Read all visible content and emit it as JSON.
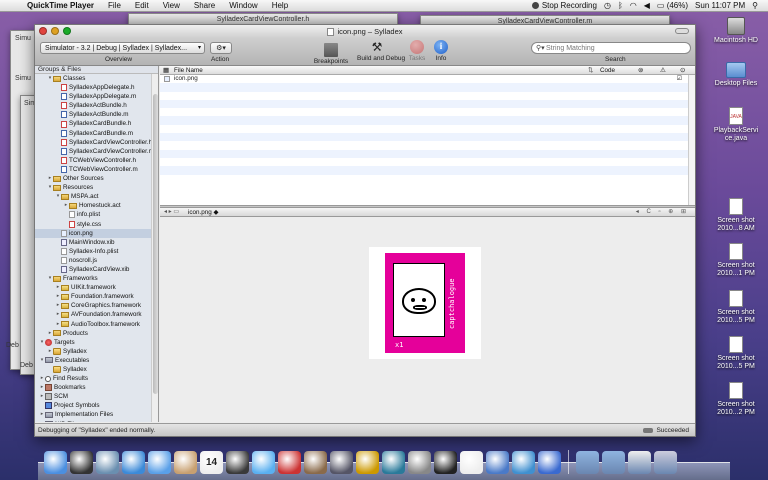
{
  "menubar": {
    "app": "QuickTime Player",
    "items": [
      "File",
      "Edit",
      "View",
      "Share",
      "Window",
      "Help"
    ],
    "stop_recording": "Stop Recording",
    "battery": "(46%)",
    "clock": "Sun 11:07 PM"
  },
  "bg_windows": {
    "header_file": "SylladexCardViewController.h",
    "impl_file": "SylladexCardViewController.m",
    "sim_tabs": [
      "Simu",
      "Simu",
      "Simu"
    ],
    "deb_labels": [
      "Deb",
      "Deb"
    ]
  },
  "xcode": {
    "title": "icon.png – Sylladex",
    "toolbar": {
      "overview_popup": "Simulator - 3.2 | Debug | Sylladex | Sylladex...",
      "overview_label": "Overview",
      "action_label": "Action",
      "breakpoints": "Breakpoints",
      "build_debug": "Build and Debug",
      "tasks": "Tasks",
      "info": "Info",
      "search_placeholder": "String Matching",
      "search_label": "Search"
    },
    "sidebar": {
      "header": "Groups & Files",
      "rows": [
        {
          "label": "Classes",
          "indent": 2,
          "icon": "folder",
          "tri": "▾"
        },
        {
          "label": "SylladexAppDelegate.h",
          "indent": 3,
          "icon": "h",
          "tri": ""
        },
        {
          "label": "SylladexAppDelegate.m",
          "indent": 3,
          "icon": "m",
          "tri": ""
        },
        {
          "label": "SylladexActBundle.h",
          "indent": 3,
          "icon": "h",
          "tri": ""
        },
        {
          "label": "SylladexActBundle.m",
          "indent": 3,
          "icon": "m",
          "tri": ""
        },
        {
          "label": "SylladexCardBundle.h",
          "indent": 3,
          "icon": "h",
          "tri": ""
        },
        {
          "label": "SylladexCardBundle.m",
          "indent": 3,
          "icon": "m",
          "tri": ""
        },
        {
          "label": "SylladexCardViewController.h",
          "indent": 3,
          "icon": "h",
          "tri": ""
        },
        {
          "label": "SylladexCardViewController.m",
          "indent": 3,
          "icon": "m",
          "tri": ""
        },
        {
          "label": "TCWebViewController.h",
          "indent": 3,
          "icon": "h",
          "tri": ""
        },
        {
          "label": "TCWebViewController.m",
          "indent": 3,
          "icon": "m",
          "tri": ""
        },
        {
          "label": "Other Sources",
          "indent": 2,
          "icon": "folder",
          "tri": "▸"
        },
        {
          "label": "Resources",
          "indent": 2,
          "icon": "folder",
          "tri": "▾"
        },
        {
          "label": "MSPA.act",
          "indent": 3,
          "icon": "folder",
          "tri": "▾"
        },
        {
          "label": "Homestuck.act",
          "indent": 4,
          "icon": "folder",
          "tri": "▸"
        },
        {
          "label": "info.plist",
          "indent": 4,
          "icon": "file",
          "tri": ""
        },
        {
          "label": "style.css",
          "indent": 4,
          "icon": "h",
          "tri": ""
        },
        {
          "label": "icon.png",
          "indent": 3,
          "icon": "png",
          "tri": "",
          "selected": true
        },
        {
          "label": "MainWindow.xib",
          "indent": 3,
          "icon": "xib",
          "tri": ""
        },
        {
          "label": "Sylladex-Info.plist",
          "indent": 3,
          "icon": "file",
          "tri": ""
        },
        {
          "label": "noscroll.js",
          "indent": 3,
          "icon": "file",
          "tri": ""
        },
        {
          "label": "SylladexCardView.xib",
          "indent": 3,
          "icon": "xib",
          "tri": ""
        },
        {
          "label": "Frameworks",
          "indent": 2,
          "icon": "folder",
          "tri": "▾"
        },
        {
          "label": "UIKit.framework",
          "indent": 3,
          "icon": "framework",
          "tri": "▸"
        },
        {
          "label": "Foundation.framework",
          "indent": 3,
          "icon": "framework",
          "tri": "▸"
        },
        {
          "label": "CoreGraphics.framework",
          "indent": 3,
          "icon": "framework",
          "tri": "▸"
        },
        {
          "label": "AVFoundation.framework",
          "indent": 3,
          "icon": "framework",
          "tri": "▸"
        },
        {
          "label": "AudioToolbox.framework",
          "indent": 3,
          "icon": "framework",
          "tri": "▸"
        },
        {
          "label": "Products",
          "indent": 2,
          "icon": "folder",
          "tri": "▸"
        },
        {
          "label": "Targets",
          "indent": 1,
          "icon": "target",
          "tri": "▾"
        },
        {
          "label": "Sylladex",
          "indent": 2,
          "icon": "app",
          "tri": "▸"
        },
        {
          "label": "Executables",
          "indent": 1,
          "icon": "grp",
          "tri": "▾"
        },
        {
          "label": "Sylladex",
          "indent": 2,
          "icon": "app",
          "tri": ""
        },
        {
          "label": "Find Results",
          "indent": 1,
          "icon": "magnif",
          "tri": "▸"
        },
        {
          "label": "Bookmarks",
          "indent": 1,
          "icon": "book",
          "tri": "▸"
        },
        {
          "label": "SCM",
          "indent": 1,
          "icon": "scm",
          "tri": "▸"
        },
        {
          "label": "Project Symbols",
          "indent": 1,
          "icon": "sym",
          "tri": ""
        },
        {
          "label": "Implementation Files",
          "indent": 1,
          "icon": "grp",
          "tri": "▸"
        },
        {
          "label": "NIB Files",
          "indent": 1,
          "icon": "grp",
          "tri": "▸"
        }
      ]
    },
    "filelist": {
      "col_name": "File Name",
      "col_code": "Code",
      "rows": [
        "icon.png"
      ]
    },
    "editor": {
      "filename": "icon.png",
      "card_text": "captchalogue",
      "card_count": "x1"
    },
    "status": {
      "message": "Debugging of \"Sylladex\" ended normally.",
      "result": "Succeeded"
    }
  },
  "desktop": [
    {
      "label": "Macintosh HD",
      "kind": "hd"
    },
    {
      "label": "Desktop Files",
      "kind": "folder"
    },
    {
      "label": "PlaybackServi ce.java",
      "kind": "java"
    },
    {
      "label": "Screen shot 2010...8 AM",
      "kind": "shot"
    },
    {
      "label": "Screen shot 2010...1 PM",
      "kind": "shot"
    },
    {
      "label": "Screen shot 2010...5 PM",
      "kind": "shot"
    },
    {
      "label": "Screen shot 2010...5 PM",
      "kind": "shot"
    },
    {
      "label": "Screen shot 2010...2 PM",
      "kind": "shot"
    }
  ],
  "dock": {
    "apps": [
      {
        "name": "finder-icon",
        "color": "#4b8fe0"
      },
      {
        "name": "dashboard-icon",
        "color": "#333"
      },
      {
        "name": "mail-stamp-icon",
        "color": "#6a8fb0"
      },
      {
        "name": "safari-icon",
        "color": "#3c8ad8"
      },
      {
        "name": "ichat-icon",
        "color": "#5aa0e8"
      },
      {
        "name": "address-book-icon",
        "color": "#c8a070"
      },
      {
        "name": "ical-icon",
        "color": "#eee"
      },
      {
        "name": "photo-booth-icon",
        "color": "#3a3a3a"
      },
      {
        "name": "itunes-icon",
        "color": "#5ab0f0"
      },
      {
        "name": "photo-icon",
        "color": "#c33"
      },
      {
        "name": "iphoto-icon",
        "color": "#8a6a4a"
      },
      {
        "name": "imovie-icon",
        "color": "#556"
      },
      {
        "name": "garageband-icon",
        "color": "#c90"
      },
      {
        "name": "time-machine-icon",
        "color": "#2a7a9a"
      },
      {
        "name": "system-prefs-icon",
        "color": "#888"
      },
      {
        "name": "terminal-icon",
        "color": "#222"
      },
      {
        "name": "xcode-icon",
        "color": "#eee"
      },
      {
        "name": "instruments-icon",
        "color": "#4a7ac8"
      },
      {
        "name": "activity-icon",
        "color": "#4090d0"
      },
      {
        "name": "quicktime-icon",
        "color": "#3a6ad0"
      }
    ],
    "right": [
      {
        "name": "applications-folder-icon",
        "color": "#8fb4e0"
      },
      {
        "name": "documents-folder-icon",
        "color": "#8fb4e0"
      },
      {
        "name": "downloads-icon",
        "color": "#eee"
      },
      {
        "name": "trash-icon",
        "color": "#ccd"
      }
    ],
    "ical_day": "14"
  }
}
